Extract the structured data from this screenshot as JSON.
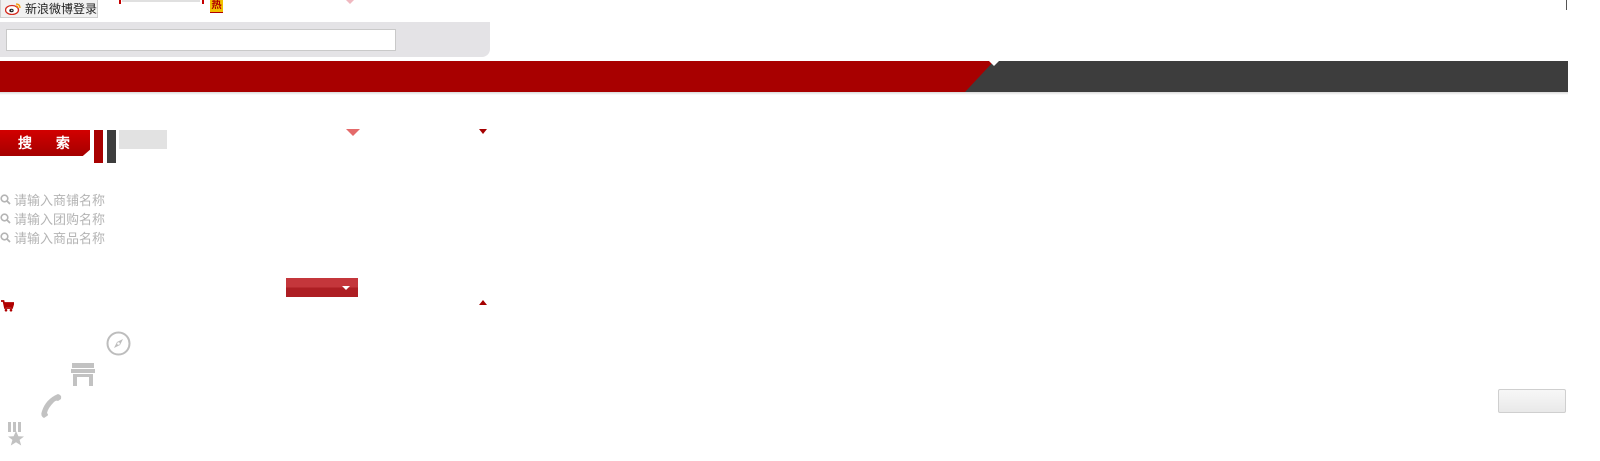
{
  "header": {
    "weibo_login_label": "新浪微博登录",
    "hot_badge": "热"
  },
  "search": {
    "input_value": "",
    "button_label": "搜 索"
  },
  "hints": [
    {
      "text": "请输入商铺名称"
    },
    {
      "text": "请输入团购名称"
    },
    {
      "text": "请输入商品名称"
    }
  ],
  "icons": {
    "search_hint": "search-icon",
    "cart": "cart-icon",
    "compass": "compass-icon",
    "shop": "shop-icon",
    "phone": "phone-icon",
    "medal": "medal-icon"
  },
  "colors": {
    "brand_red": "#a80000",
    "nav_dark": "#3d3d3d",
    "hint_gray": "#b4b4b4"
  }
}
